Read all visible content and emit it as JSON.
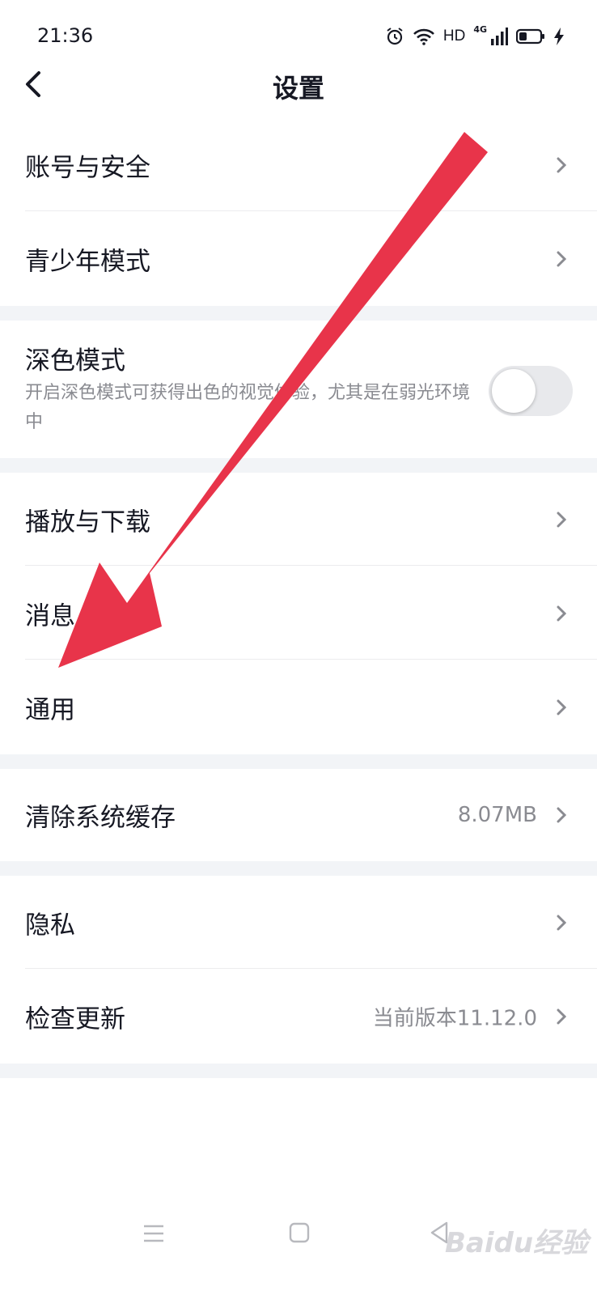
{
  "status_bar": {
    "time": "21:36",
    "hd": "HD",
    "network": "4G"
  },
  "header": {
    "title": "设置"
  },
  "rows": {
    "account": {
      "label": "账号与安全"
    },
    "teen": {
      "label": "青少年模式"
    },
    "dark": {
      "title": "深色模式",
      "description": "开启深色模式可获得出色的视觉体验，尤其是在弱光环境中",
      "enabled": false
    },
    "playback": {
      "label": "播放与下载"
    },
    "message": {
      "label": "消息"
    },
    "general": {
      "label": "通用"
    },
    "cache": {
      "label": "清除系统缓存",
      "value": "8.07MB"
    },
    "privacy": {
      "label": "隐私"
    },
    "update": {
      "label": "检查更新",
      "value": "当前版本11.12.0"
    }
  },
  "annotation": {
    "arrow_color": "#e8344a"
  },
  "watermark": {
    "text": "Baidu经验"
  },
  "colors": {
    "background": "#ffffff",
    "section_gap": "#f2f4f7",
    "text": "#161823",
    "secondary_text": "#8a8b91"
  }
}
